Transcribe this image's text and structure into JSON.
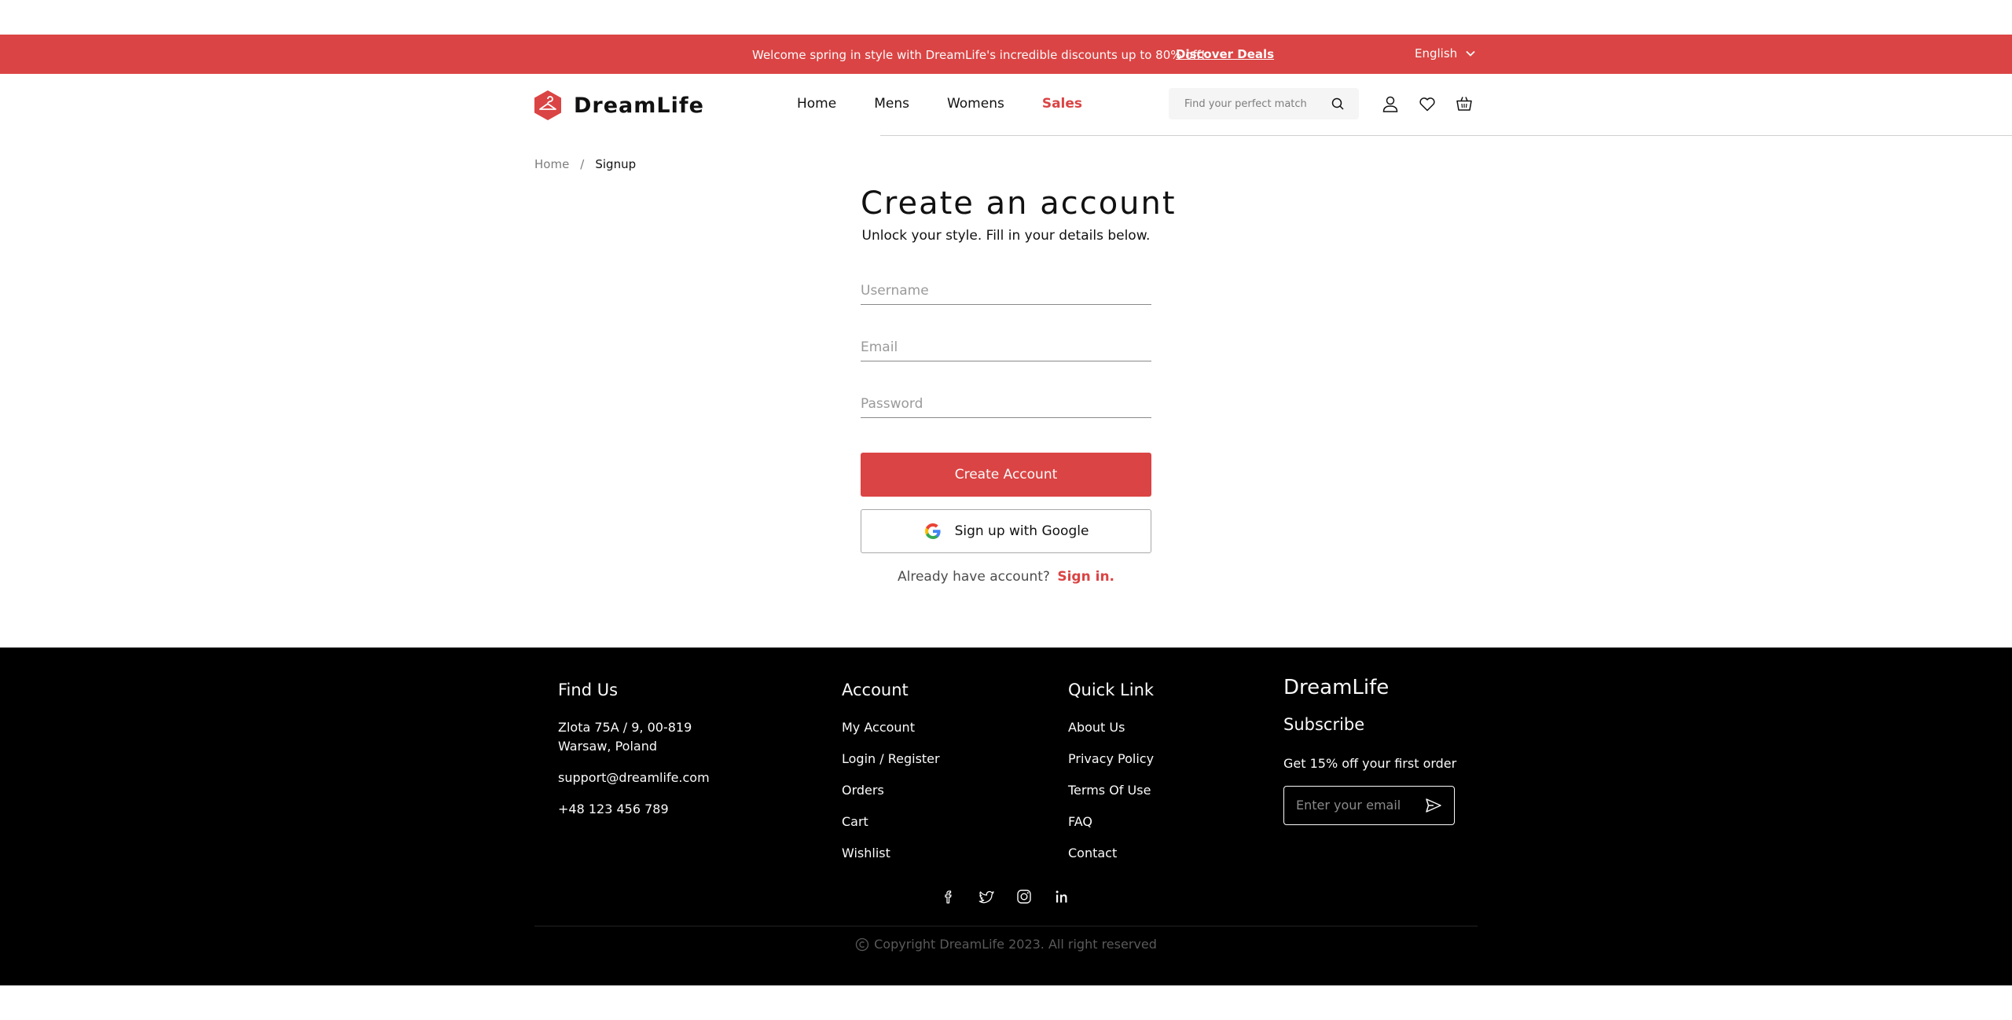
{
  "promo": {
    "text": "Welcome spring in style with DreamLife's incredible discounts up to 80% off!",
    "link": "Discover Deals",
    "language": "English"
  },
  "header": {
    "brand": "DreamLife",
    "nav": [
      "Home",
      "Mens",
      "Womens",
      "Sales"
    ],
    "search_placeholder": "Find your perfect match"
  },
  "breadcrumb": {
    "home": "Home",
    "separator": "/",
    "current": "Signup"
  },
  "form": {
    "title": "Create an account",
    "subtitle": "Unlock your style. Fill in your details below.",
    "username_placeholder": "Username",
    "email_placeholder": "Email",
    "password_placeholder": "Password",
    "create_button": "Create Account",
    "google_button": "Sign up with Google",
    "already_text": "Already have account?",
    "signin_link": "Sign in."
  },
  "footer": {
    "find_us": {
      "title": "Find Us",
      "address_line1": "Zlota 75A / 9, 00-819",
      "address_line2": "Warsaw, Poland",
      "email": "support@dreamlife.com",
      "phone": "+48 123 456 789"
    },
    "account": {
      "title": "Account",
      "items": [
        "My Account",
        "Login / Register",
        "Orders",
        "Cart",
        "Wishlist"
      ]
    },
    "quick_link": {
      "title": "Quick Link",
      "items": [
        "About Us",
        "Privacy Policy",
        "Terms Of Use",
        "FAQ",
        "Contact"
      ]
    },
    "brand": "DreamLife",
    "subscribe_title": "Subscribe",
    "subscribe_text": "Get 15% off your first order",
    "subscribe_placeholder": "Enter your email",
    "socials": [
      "facebook-icon",
      "twitter-icon",
      "instagram-icon",
      "linkedin-icon"
    ],
    "copyright": "Copyright DreamLife 2023. All right reserved"
  },
  "colors": {
    "accent": "#db4444",
    "footer_bg": "#000000"
  }
}
